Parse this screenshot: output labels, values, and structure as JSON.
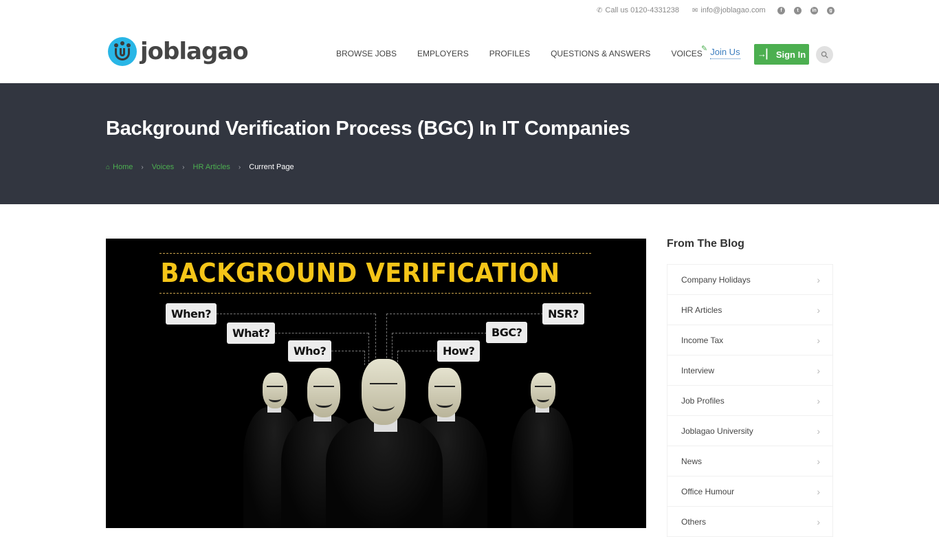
{
  "topbar": {
    "phone_icon": "phone-icon",
    "phone": "Call us 0120-4331238",
    "email_icon": "envelope-icon",
    "email": "info@joblagao.com",
    "social": [
      {
        "name": "facebook-icon",
        "glyph": "f"
      },
      {
        "name": "twitter-icon",
        "glyph": "t"
      },
      {
        "name": "linkedin-icon",
        "glyph": "in"
      },
      {
        "name": "google-plus-icon",
        "glyph": "g"
      }
    ]
  },
  "header": {
    "logo_text": "joblagao",
    "nav": [
      "BROWSE JOBS",
      "EMPLOYERS",
      "PROFILES",
      "QUESTIONS & ANSWERS",
      "VOICES"
    ],
    "join_us": "Join Us",
    "sign_in": "Sign In",
    "search_icon": "search-icon",
    "accent_color": "#4caf50"
  },
  "page": {
    "title": "Background Verification Process (BGC) In IT Companies",
    "breadcrumb": [
      {
        "label": "Home",
        "link": true
      },
      {
        "label": "Voices",
        "link": true
      },
      {
        "label": "HR Articles",
        "link": true
      },
      {
        "label": "Current Page",
        "link": false
      }
    ],
    "band_color": "#323640"
  },
  "hero": {
    "headline": "BACKGROUND VERIFICATION",
    "questions": [
      "When?",
      "What?",
      "Who?",
      "How?",
      "BGC?",
      "NSR?"
    ]
  },
  "sidebar": {
    "title": "From The Blog",
    "items": [
      "Company Holidays",
      "HR Articles",
      "Income Tax",
      "Interview",
      "Job Profiles",
      "Joblagao University",
      "News",
      "Office Humour",
      "Others"
    ]
  }
}
